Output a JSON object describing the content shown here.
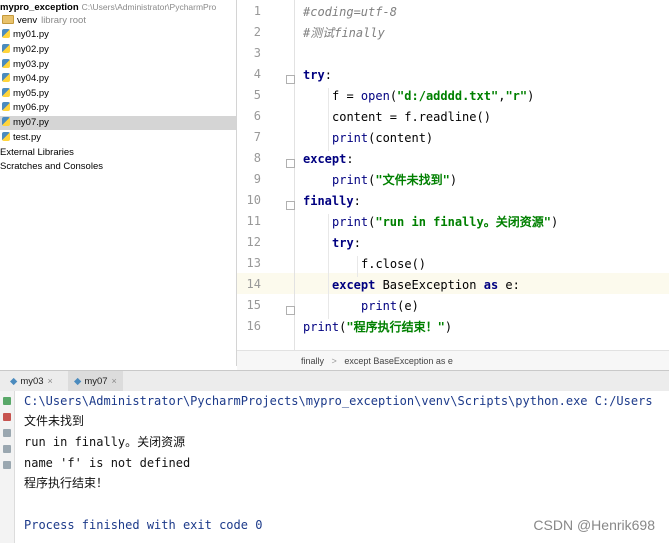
{
  "project": {
    "root_name": "mypro_exception",
    "root_path": "C:\\Users\\Administrator\\PycharmPro",
    "venv_name": "venv",
    "venv_note": "library root",
    "files": [
      "my01.py",
      "my02.py",
      "my03.py",
      "my04.py",
      "my05.py",
      "my06.py",
      "my07.py",
      "test.py"
    ],
    "selected_file": "my07.py",
    "external_libraries": "External Libraries",
    "scratches": "Scratches and Consoles"
  },
  "editor": {
    "line_numbers": [
      "1",
      "2",
      "3",
      "4",
      "5",
      "6",
      "7",
      "8",
      "9",
      "10",
      "11",
      "12",
      "13",
      "14",
      "15",
      "16"
    ],
    "current_line": "14",
    "code": {
      "l1": "#coding=utf-8",
      "l2": "#测试finally",
      "l4_kw": "try",
      "l5_a": "f = ",
      "l5_fn": "open",
      "l5_s1": "\"d:/adddd.txt\"",
      "l5_s2": "\"r\"",
      "l6": "content = f.readline()",
      "l7_fn": "print",
      "l7_arg": "(content)",
      "l8_kw": "except",
      "l9_fn": "print",
      "l9_s": "\"文件未找到\"",
      "l10_kw": "finally",
      "l11_fn": "print",
      "l11_s": "\"run in finally。关闭资源\"",
      "l12_kw": "try",
      "l13": "f.close()",
      "l14_kw1": "except",
      "l14_mid": " BaseException ",
      "l14_kw2": "as",
      "l14_end": " e:",
      "l15_fn": "print",
      "l15_arg": "(e)",
      "l16_fn": "print",
      "l16_s": "\"程序执行结束！\""
    }
  },
  "breadcrumb": {
    "item1": "finally",
    "sep": ">",
    "item2": "except BaseException as e"
  },
  "run": {
    "tabs": [
      "my03",
      "my07"
    ],
    "active_tab": "my07",
    "output": [
      "C:\\Users\\Administrator\\PycharmProjects\\mypro_exception\\venv\\Scripts\\python.exe C:/Users",
      "文件未找到",
      "run in finally。关闭资源",
      "name 'f' is not defined",
      "程序执行结束！",
      "",
      "Process finished with exit code 0"
    ]
  },
  "watermark": "CSDN @Henrik698"
}
